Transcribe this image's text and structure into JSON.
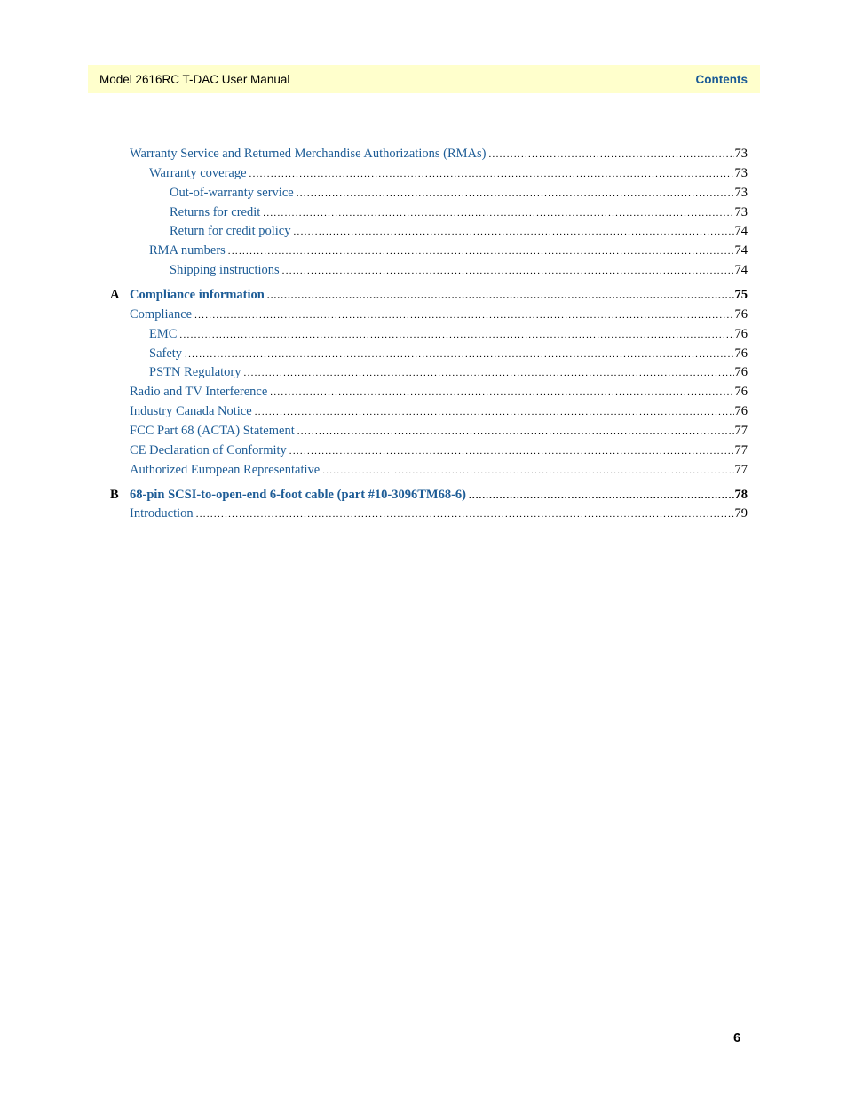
{
  "header": {
    "manual_title": "Model 2616RC T-DAC User Manual",
    "section": "Contents"
  },
  "toc": [
    {
      "label": "Warranty Service and Returned Merchandise Authorizations (RMAs)",
      "page": "73",
      "level": 1
    },
    {
      "label": "Warranty coverage",
      "page": "73",
      "level": 2
    },
    {
      "label": "Out-of-warranty service",
      "page": "73",
      "level": 3
    },
    {
      "label": "Returns for credit",
      "page": "73",
      "level": 3
    },
    {
      "label": "Return for credit policy",
      "page": "74",
      "level": 3
    },
    {
      "label": "RMA numbers",
      "page": "74",
      "level": 2
    },
    {
      "label": "Shipping instructions",
      "page": "74",
      "level": 3
    },
    {
      "appendix": "A",
      "label": "Compliance information",
      "page": "75",
      "level": 0
    },
    {
      "label": "Compliance",
      "page": "76",
      "level": 1
    },
    {
      "label": "EMC",
      "page": "76",
      "level": 2
    },
    {
      "label": "Safety",
      "page": "76",
      "level": 2
    },
    {
      "label": "PSTN Regulatory",
      "page": "76",
      "level": 2
    },
    {
      "label": "Radio and TV Interference",
      "page": "76",
      "level": 1
    },
    {
      "label": "Industry Canada Notice",
      "page": "76",
      "level": 1
    },
    {
      "label": "FCC Part 68 (ACTA) Statement",
      "page": "77",
      "level": 1
    },
    {
      "label": "CE Declaration of Conformity",
      "page": "77",
      "level": 1
    },
    {
      "label": "Authorized European Representative",
      "page": "77",
      "level": 1
    },
    {
      "appendix": "B",
      "label": "68-pin SCSI-to-open-end 6-foot cable (part #10-3096TM68-6)",
      "page": "78",
      "level": 0
    },
    {
      "label": "Introduction",
      "page": "79",
      "level": 1
    }
  ],
  "footer": {
    "page_number": "6"
  }
}
